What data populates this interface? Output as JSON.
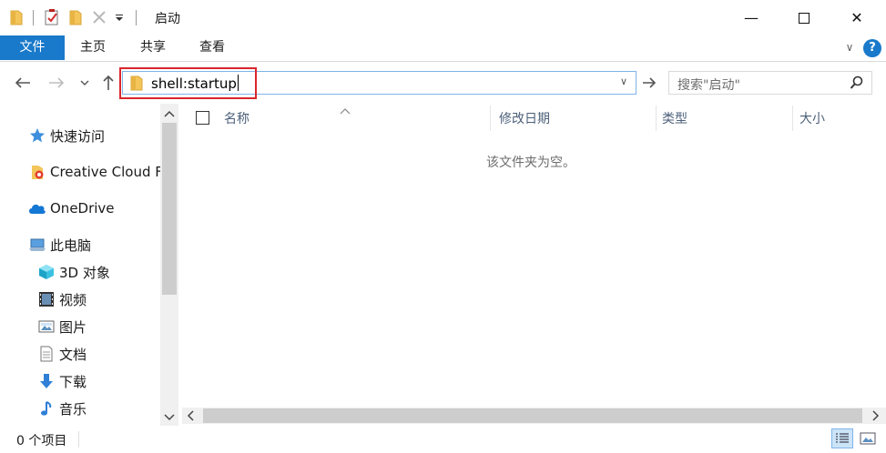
{
  "window": {
    "title": "启动",
    "minimize_glyph": "—",
    "maximize_glyph": "☐",
    "close_glyph": "✕"
  },
  "ribbon": {
    "tabs": [
      "文件",
      "主页",
      "共享",
      "查看"
    ],
    "collapse_glyph": "∨",
    "help_glyph": "?"
  },
  "address": {
    "value": "shell:startup",
    "dropdown_glyph": "∨",
    "go_glyph": "→"
  },
  "search": {
    "placeholder": "搜索\"启动\""
  },
  "nav": {
    "items": [
      {
        "label": "快速访问",
        "icon": "star-icon"
      },
      {
        "label": "Creative Cloud F",
        "icon": "creative-cloud-icon"
      },
      {
        "label": "OneDrive",
        "icon": "onedrive-cloud-icon"
      },
      {
        "label": "此电脑",
        "icon": "computer-icon"
      },
      {
        "label": "3D 对象",
        "icon": "cube-3d-icon"
      },
      {
        "label": "视频",
        "icon": "video-icon"
      },
      {
        "label": "图片",
        "icon": "picture-icon"
      },
      {
        "label": "文档",
        "icon": "document-icon"
      },
      {
        "label": "下载",
        "icon": "download-arrow-icon"
      },
      {
        "label": "音乐",
        "icon": "music-note-icon"
      }
    ]
  },
  "content": {
    "columns": [
      "名称",
      "修改日期",
      "类型",
      "大小"
    ],
    "empty_message": "该文件夹为空。"
  },
  "status": {
    "item_count": "0 个项目"
  },
  "colors": {
    "accent": "#1979ca",
    "highlight_border": "#d9262c",
    "folder_yellow": "#f3c55a"
  }
}
